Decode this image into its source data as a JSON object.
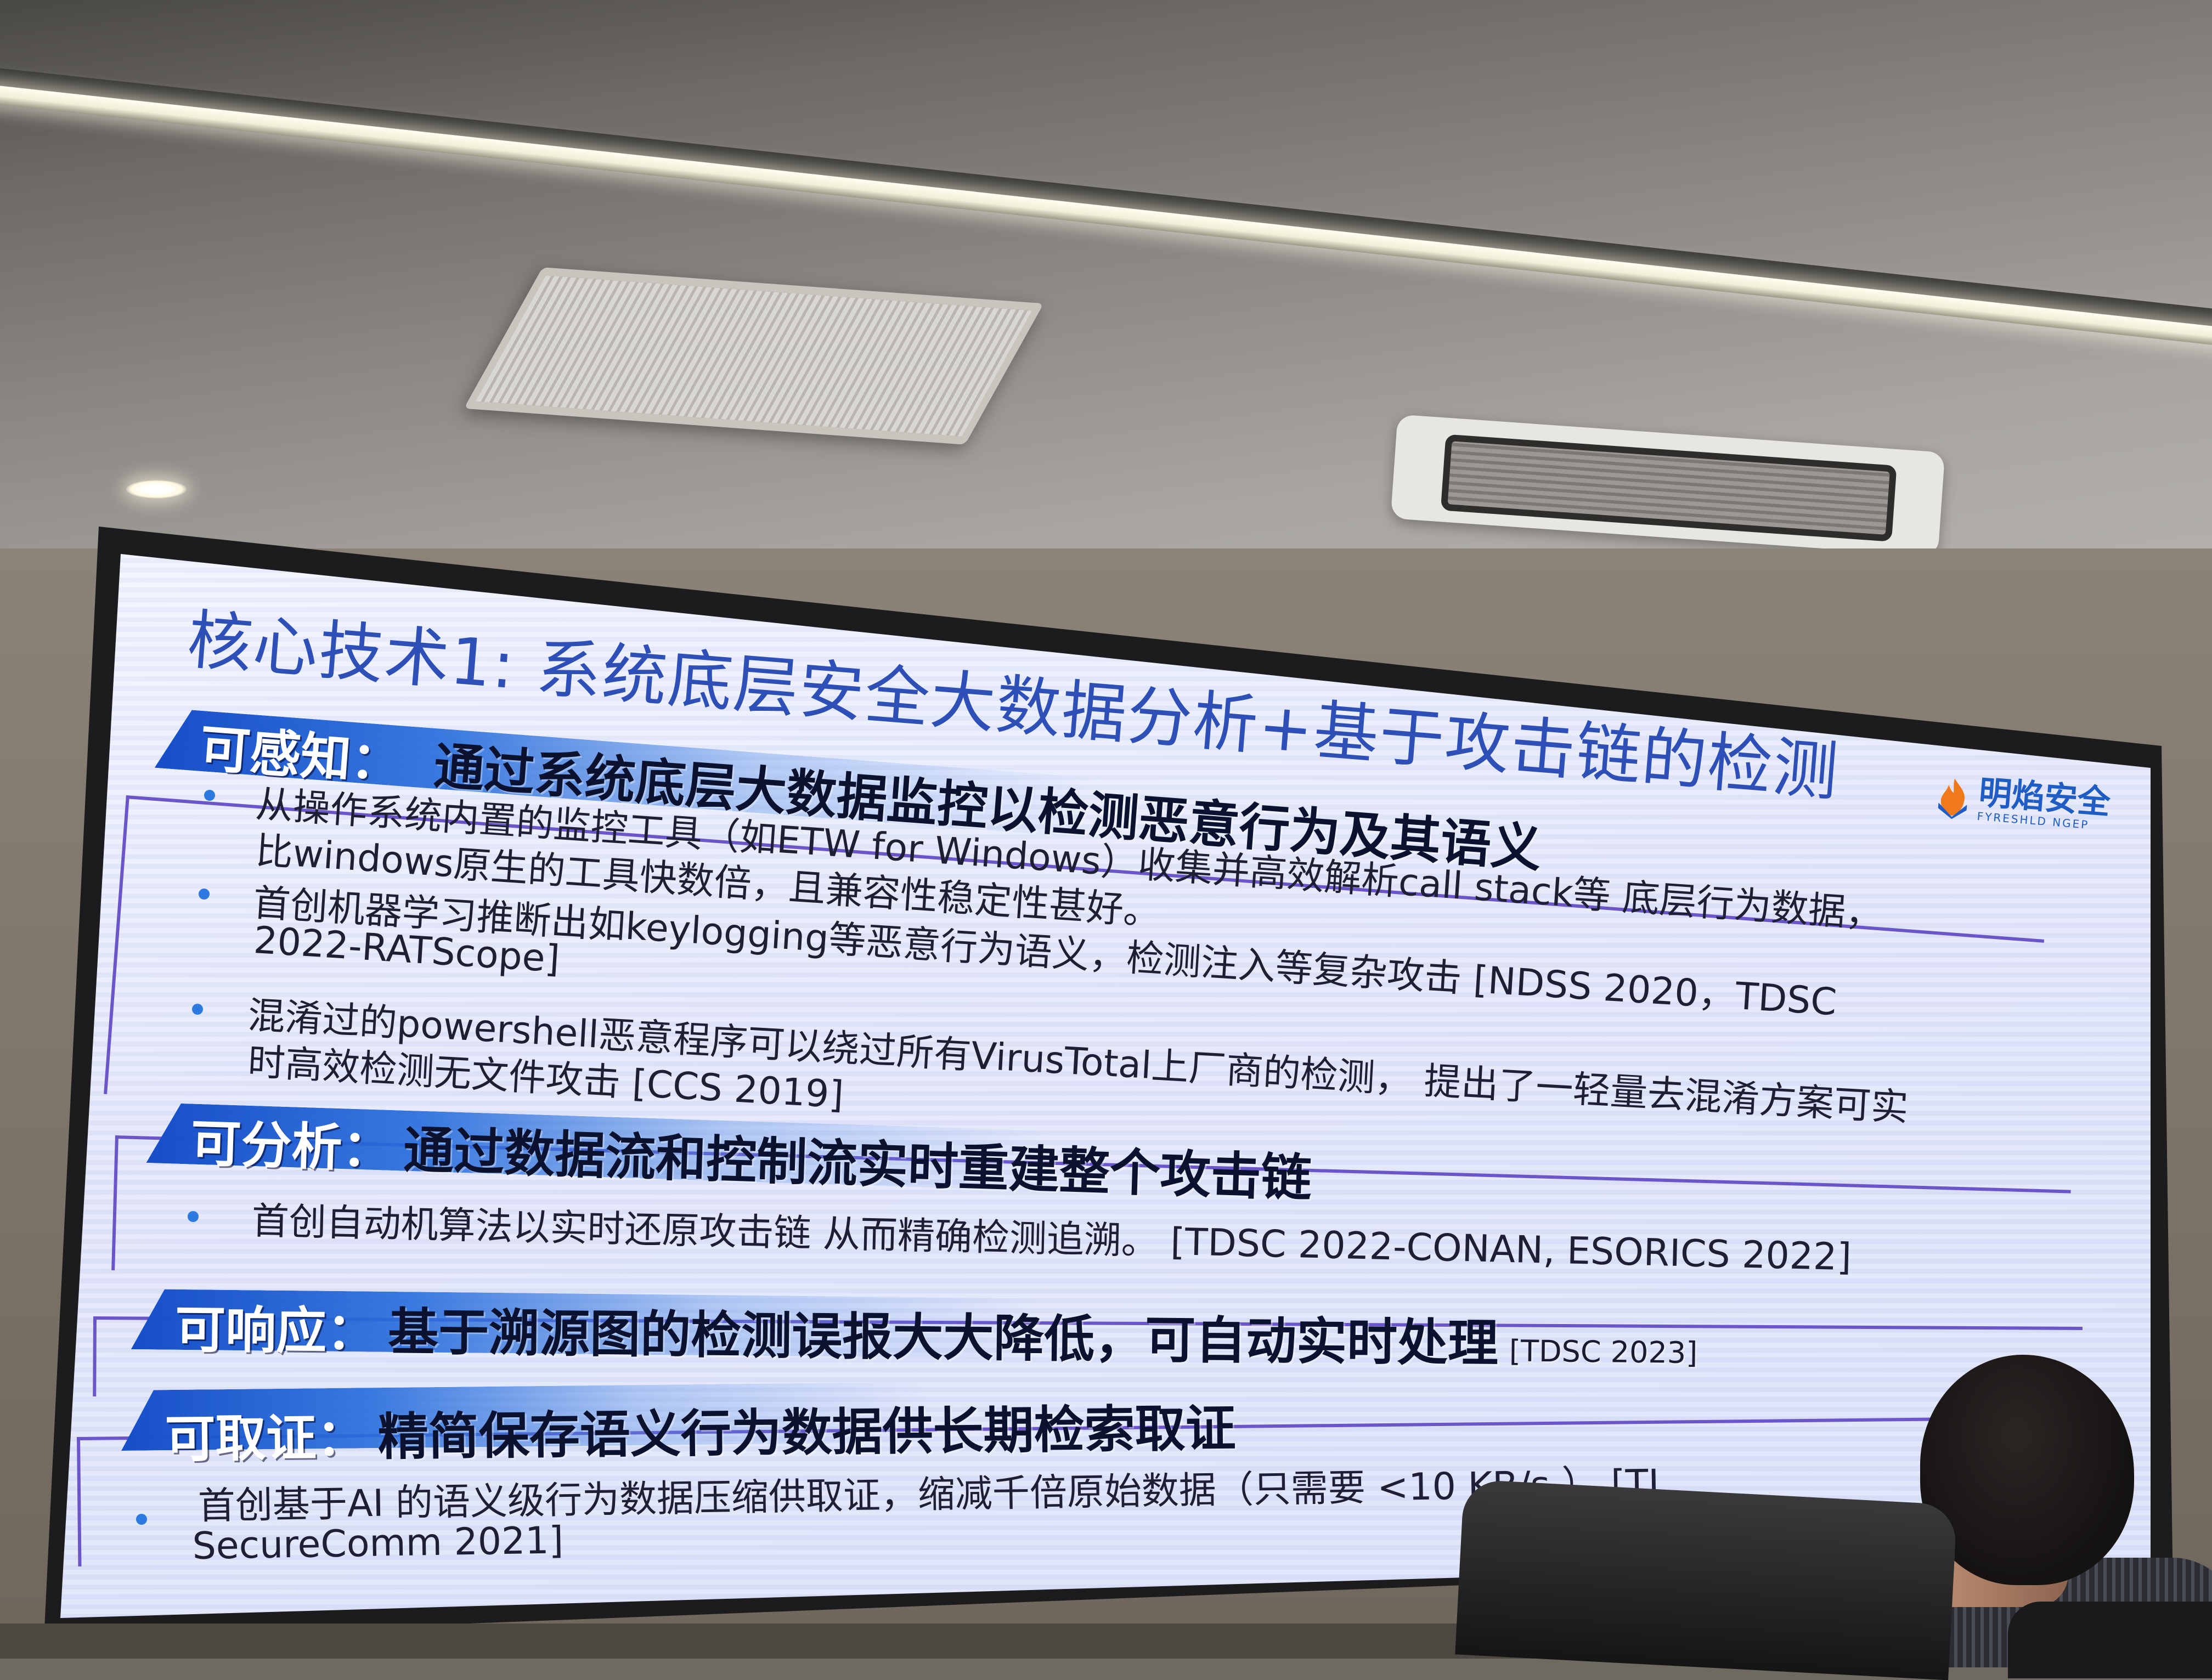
{
  "slide": {
    "title": "核心技术1: 系统底层安全大数据分析+基于攻击链的检测",
    "logo": {
      "name_cn": "明焰安全",
      "name_en": "FYRESHLD NGEP"
    },
    "sections": [
      {
        "key": "可感知：",
        "heading": "通过系统底层大数据监控以检测恶意行为及其语义",
        "bullets": [
          {
            "lines": [
              "从操作系统内置的监控工具（如ETW for Windows）收集并高效解析call stack等 底层行为数据，",
              "比windows原生的工具快数倍，且兼容性稳定性甚好。"
            ]
          },
          {
            "lines": [
              "首创机器学习推断出如keylogging等恶意行为语义，检测注入等复杂攻击 [NDSS 2020，TDSC",
              "2022-RATScope]"
            ]
          },
          {
            "lines": [
              "混淆过的powershell恶意程序可以绕过所有VirusTotal上厂商的检测， 提出了一轻量去混淆方案可实",
              "时高效检测无文件攻击 [CCS 2019]"
            ]
          }
        ]
      },
      {
        "key": "可分析：",
        "heading": "通过数据流和控制流实时重建整个攻击链",
        "bullets": [
          {
            "lines": [
              "首创自动机算法以实时还原攻击链 从而精确检测追溯。 [TDSC 2022-CONAN, ESORICS 2022]"
            ]
          }
        ]
      },
      {
        "key": "可响应：",
        "heading": "基于溯源图的检测误报大大降低，可自动实时处理",
        "ref": "[TDSC 2023]",
        "bullets": []
      },
      {
        "key": "可取证：",
        "heading": "精简保存语义行为数据供长期检索取证",
        "bullets": [
          {
            "lines": [
              "首创基于AI 的语义级行为数据压缩供取证，缩减千倍原始数据（只需要 <10 KB/s ） [TI",
              "SecureComm 2021]"
            ]
          }
        ]
      }
    ]
  },
  "colors": {
    "title": "#2d4fb6",
    "section_bar": "#164ec8",
    "bullet_dot": "#2c79e0",
    "slide_background": "#e4e8fb"
  },
  "icons": [
    "flame-logo-icon",
    "bullet-dot-icon"
  ]
}
